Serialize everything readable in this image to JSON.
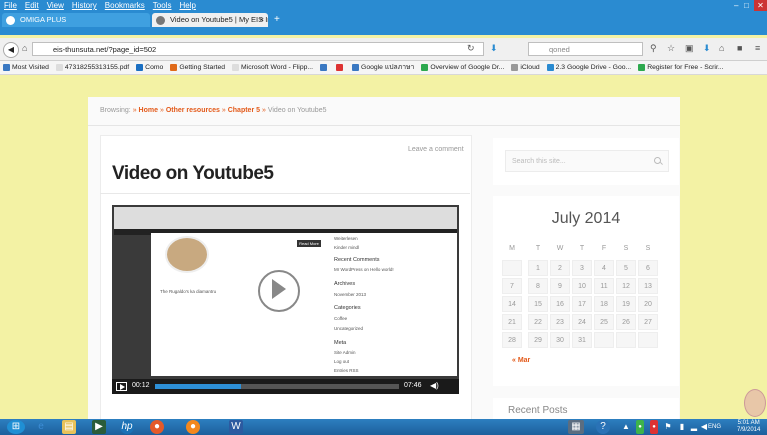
{
  "menu": [
    "File",
    "Edit",
    "View",
    "History",
    "Bookmarks",
    "Tools",
    "Help"
  ],
  "tabs": [
    {
      "label": "OMIGA PLUS"
    },
    {
      "label": "Video on Youtube5 | My EIS Inn..."
    }
  ],
  "tab_close": "×",
  "new_tab": "+",
  "url": "eis-thunsuta.net/?page_id=502",
  "search_placeholder": "qoned",
  "bookmarks": [
    {
      "label": "Most Visited",
      "color": "#3a78c2"
    },
    {
      "label": "47318255313155.pdf",
      "color": "#dddddd"
    },
    {
      "label": "Como",
      "color": "#1a6fc2"
    },
    {
      "label": "Getting Started",
      "color": "#e06a1a"
    },
    {
      "label": "Microsoft Word - Flipp...",
      "color": "#dddddd"
    },
    {
      "label": "",
      "color": "#3a78c2"
    },
    {
      "label": "",
      "color": "#d33"
    },
    {
      "label": "Google แปลภาษา",
      "color": "#3a78c2"
    },
    {
      "label": "Overview of Google Dr...",
      "color": "#2da94f"
    },
    {
      "label": "iCloud",
      "color": "#999999"
    },
    {
      "label": "2.3 Google Drive - Goo...",
      "color": "#2a8bd1"
    },
    {
      "label": "Register for Free - Scrir...",
      "color": "#2da94f"
    }
  ],
  "breadcrumb": {
    "prefix": "Browsing:",
    "sep": "»",
    "items": [
      "Home",
      "Other resources",
      "Chapter 5"
    ],
    "current": "Video on Youtube5"
  },
  "post": {
    "leave_comment": "Leave a comment",
    "title": "Video on Youtube5"
  },
  "video": {
    "current_time": "00:12",
    "duration": "07:46",
    "progress": 0.026,
    "read_more": "Read More",
    "inner_caption": "The Rugaldo's ka diamantru",
    "side_items": [
      "Weiterlesen",
      "Kinder mindl",
      "Recent Comments",
      "Mr WordPress on Hello world!",
      "Archives",
      "November 2013",
      "Categories",
      "Coffee",
      "Uncategorized",
      "Meta",
      "Site Admin",
      "Log out",
      "Entries RSS"
    ]
  },
  "sidebar": {
    "search_placeholder": "Search this site...",
    "calendar": {
      "title": "July 2014",
      "days": [
        "M",
        "T",
        "W",
        "T",
        "F",
        "S",
        "S"
      ],
      "weeks": [
        [
          "",
          "1",
          "2",
          "3",
          "4",
          "5",
          "6"
        ],
        [
          "7",
          "8",
          "9",
          "10",
          "11",
          "12",
          "13"
        ],
        [
          "14",
          "15",
          "16",
          "17",
          "18",
          "19",
          "20"
        ],
        [
          "21",
          "22",
          "23",
          "24",
          "25",
          "26",
          "27"
        ],
        [
          "28",
          "29",
          "30",
          "31",
          "",
          "",
          ""
        ]
      ],
      "prev": "« Mar"
    },
    "recent_posts": "Recent Posts"
  },
  "taskbar": {
    "lang": "ENG",
    "time": "5:01 AM",
    "date": "7/9/2014"
  }
}
